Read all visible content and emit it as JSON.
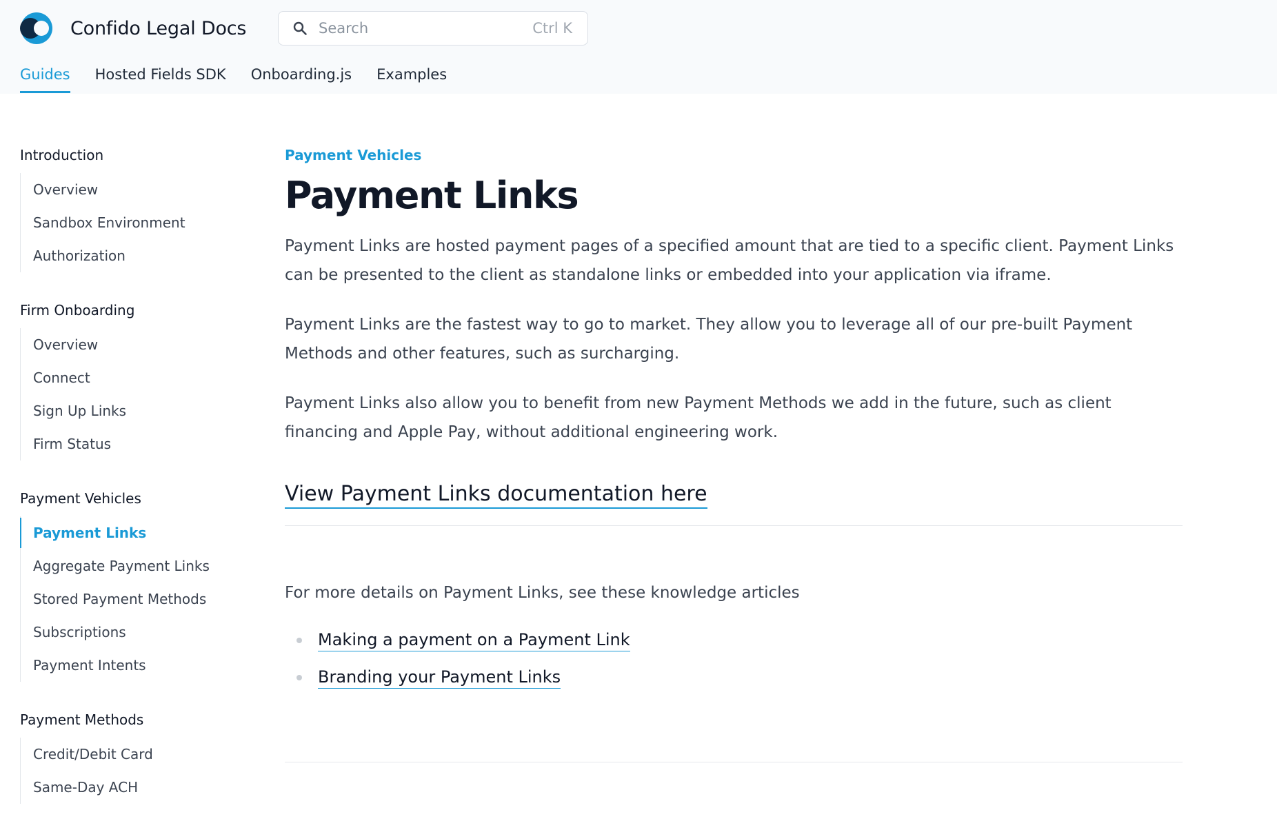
{
  "header": {
    "brand_name": "Confido Legal Docs",
    "search": {
      "placeholder": "Search",
      "shortcut": "Ctrl K"
    },
    "tabs": [
      {
        "label": "Guides",
        "active": true
      },
      {
        "label": "Hosted Fields SDK",
        "active": false
      },
      {
        "label": "Onboarding.js",
        "active": false
      },
      {
        "label": "Examples",
        "active": false
      }
    ]
  },
  "sidebar": {
    "sections": [
      {
        "heading": "Introduction",
        "items": [
          "Overview",
          "Sandbox Environment",
          "Authorization"
        ]
      },
      {
        "heading": "Firm Onboarding",
        "items": [
          "Overview",
          "Connect",
          "Sign Up Links",
          "Firm Status"
        ]
      },
      {
        "heading": "Payment Vehicles",
        "items": [
          "Payment Links",
          "Aggregate Payment Links",
          "Stored Payment Methods",
          "Subscriptions",
          "Payment Intents"
        ],
        "active_item": "Payment Links"
      },
      {
        "heading": "Payment Methods",
        "items": [
          "Credit/Debit Card",
          "Same-Day ACH"
        ]
      }
    ]
  },
  "main": {
    "eyebrow": "Payment Vehicles",
    "title": "Payment Links",
    "paragraphs": [
      "Payment Links are hosted payment pages of a specified amount that are tied to a specific client. Payment Links can be presented to the client as standalone links or embedded into your application via iframe.",
      "Payment Links are the fastest way to go to market. They allow you to leverage all of our pre-built Payment Methods and other features, such as surcharging.",
      "Payment Links also allow you to benefit from new Payment Methods we add in the future, such as client financing and Apple Pay, without additional engineering work."
    ],
    "doc_link": "View Payment Links documentation here",
    "more_text": "For more details on Payment Links, see these knowledge articles",
    "articles": [
      "Making a payment on a Payment Link",
      "Branding your Payment Links"
    ]
  },
  "colors": {
    "accent": "#1a9ad6",
    "logo_dark": "#0f2a44",
    "text": "#1f2937",
    "muted": "#3b4350"
  }
}
